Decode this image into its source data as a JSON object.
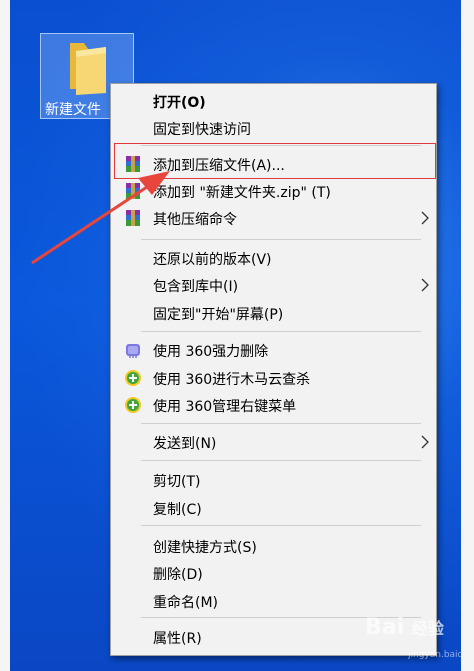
{
  "desktop": {
    "folder_label": "新建文件"
  },
  "menu": {
    "items": [
      {
        "label": "打开(O)",
        "bold": true,
        "icon": null,
        "submenu": false
      },
      {
        "label": "固定到快速访问",
        "icon": null,
        "submenu": false
      },
      {
        "label": "添加到压缩文件(A)...",
        "icon": "winrar-icon",
        "submenu": false
      },
      {
        "label": "添加到 \"新建文件夹.zip\" (T)",
        "icon": "winrar-icon",
        "submenu": false
      },
      {
        "label": "其他压缩命令",
        "icon": "winrar-icon",
        "submenu": true
      },
      {
        "label": "还原以前的版本(V)",
        "icon": null,
        "submenu": false
      },
      {
        "label": "包含到库中(I)",
        "icon": null,
        "submenu": true
      },
      {
        "label": "固定到\"开始\"屏幕(P)",
        "icon": null,
        "submenu": false
      },
      {
        "label": "使用 360强力删除",
        "icon": "shredder-icon",
        "submenu": false
      },
      {
        "label": "使用 360进行木马云查杀",
        "icon": "360-plus-icon",
        "submenu": false
      },
      {
        "label": "使用 360管理右键菜单",
        "icon": "360-plus-icon",
        "submenu": false
      },
      {
        "label": "发送到(N)",
        "icon": null,
        "submenu": true
      },
      {
        "label": "剪切(T)",
        "icon": null,
        "submenu": false
      },
      {
        "label": "复制(C)",
        "icon": null,
        "submenu": false
      },
      {
        "label": "创建快捷方式(S)",
        "icon": null,
        "submenu": false
      },
      {
        "label": "删除(D)",
        "icon": null,
        "submenu": false
      },
      {
        "label": "重命名(M)",
        "icon": null,
        "submenu": false
      },
      {
        "label": "属性(R)",
        "icon": null,
        "submenu": false
      }
    ]
  },
  "watermark": {
    "brand": "Bai",
    "brand2": "经验",
    "sub": "jingyan.baidu.com"
  },
  "colors": {
    "desktop": "#0a54d8",
    "menu_bg": "#f2f2f2",
    "highlight_border": "#e03a3a",
    "arrow": "#e8453c"
  }
}
